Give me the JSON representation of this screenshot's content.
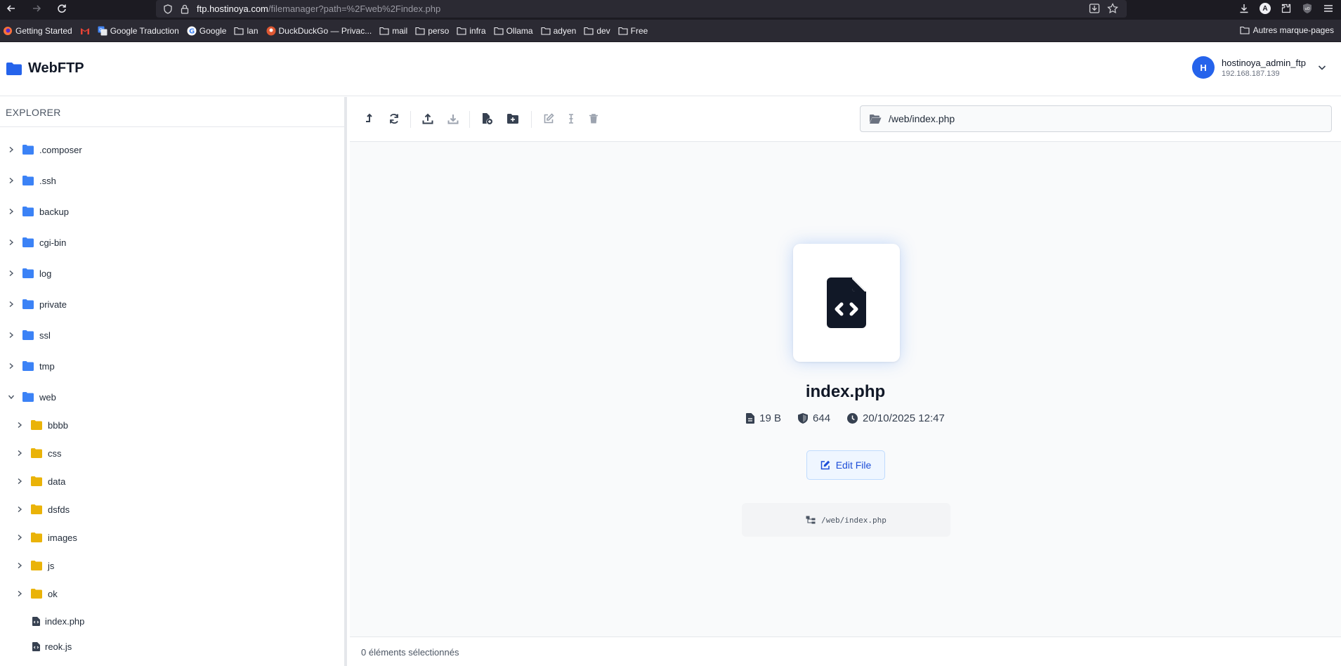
{
  "browser": {
    "url_host": "ftp.hostinoya.com",
    "url_path": "/filemanager?path=%2Fweb%2Findex.php",
    "bookmarks": [
      {
        "label": "Getting Started",
        "icon": "firefox-icon"
      },
      {
        "label": "",
        "icon": "gmail-icon"
      },
      {
        "label": "Google Traduction",
        "icon": "google-translate-icon"
      },
      {
        "label": "Google",
        "icon": "google-icon"
      },
      {
        "label": "lan",
        "icon": "folder-icon"
      },
      {
        "label": "DuckDuckGo — Privac...",
        "icon": "duckduckgo-icon"
      },
      {
        "label": "mail",
        "icon": "folder-icon"
      },
      {
        "label": "perso",
        "icon": "folder-icon"
      },
      {
        "label": "infra",
        "icon": "folder-icon"
      },
      {
        "label": "Ollama",
        "icon": "folder-icon"
      },
      {
        "label": "adyen",
        "icon": "folder-icon"
      },
      {
        "label": "dev",
        "icon": "folder-icon"
      },
      {
        "label": "Free",
        "icon": "folder-icon"
      }
    ],
    "other_bookmarks": "Autres marque-pages"
  },
  "app": {
    "name": "WebFTP",
    "accent": "#2563eb"
  },
  "user": {
    "initial": "H",
    "name": "hostinoya_admin_ftp",
    "ip": "192.168.187.139"
  },
  "sidebar": {
    "title": "EXPLORER",
    "root_items": [
      {
        "label": ".composer"
      },
      {
        "label": ".ssh"
      },
      {
        "label": "backup"
      },
      {
        "label": "cgi-bin"
      },
      {
        "label": "log"
      },
      {
        "label": "private"
      },
      {
        "label": "ssl"
      },
      {
        "label": "tmp"
      },
      {
        "label": "web",
        "expanded": true
      }
    ],
    "web_children": [
      {
        "label": "bbbb"
      },
      {
        "label": "css"
      },
      {
        "label": "data"
      },
      {
        "label": "dsfds"
      },
      {
        "label": "images"
      },
      {
        "label": "js"
      },
      {
        "label": "ok"
      }
    ],
    "web_files": [
      {
        "label": "index.php"
      },
      {
        "label": "reok.js"
      }
    ]
  },
  "toolbar": {
    "path": "/web/index.php"
  },
  "file": {
    "name": "index.php",
    "size": "19 B",
    "permissions": "644",
    "modified": "20/10/2025 12:47",
    "edit_label": "Edit File",
    "full_path": "/web/index.php"
  },
  "status": {
    "selected": "0 éléments sélectionnés"
  }
}
